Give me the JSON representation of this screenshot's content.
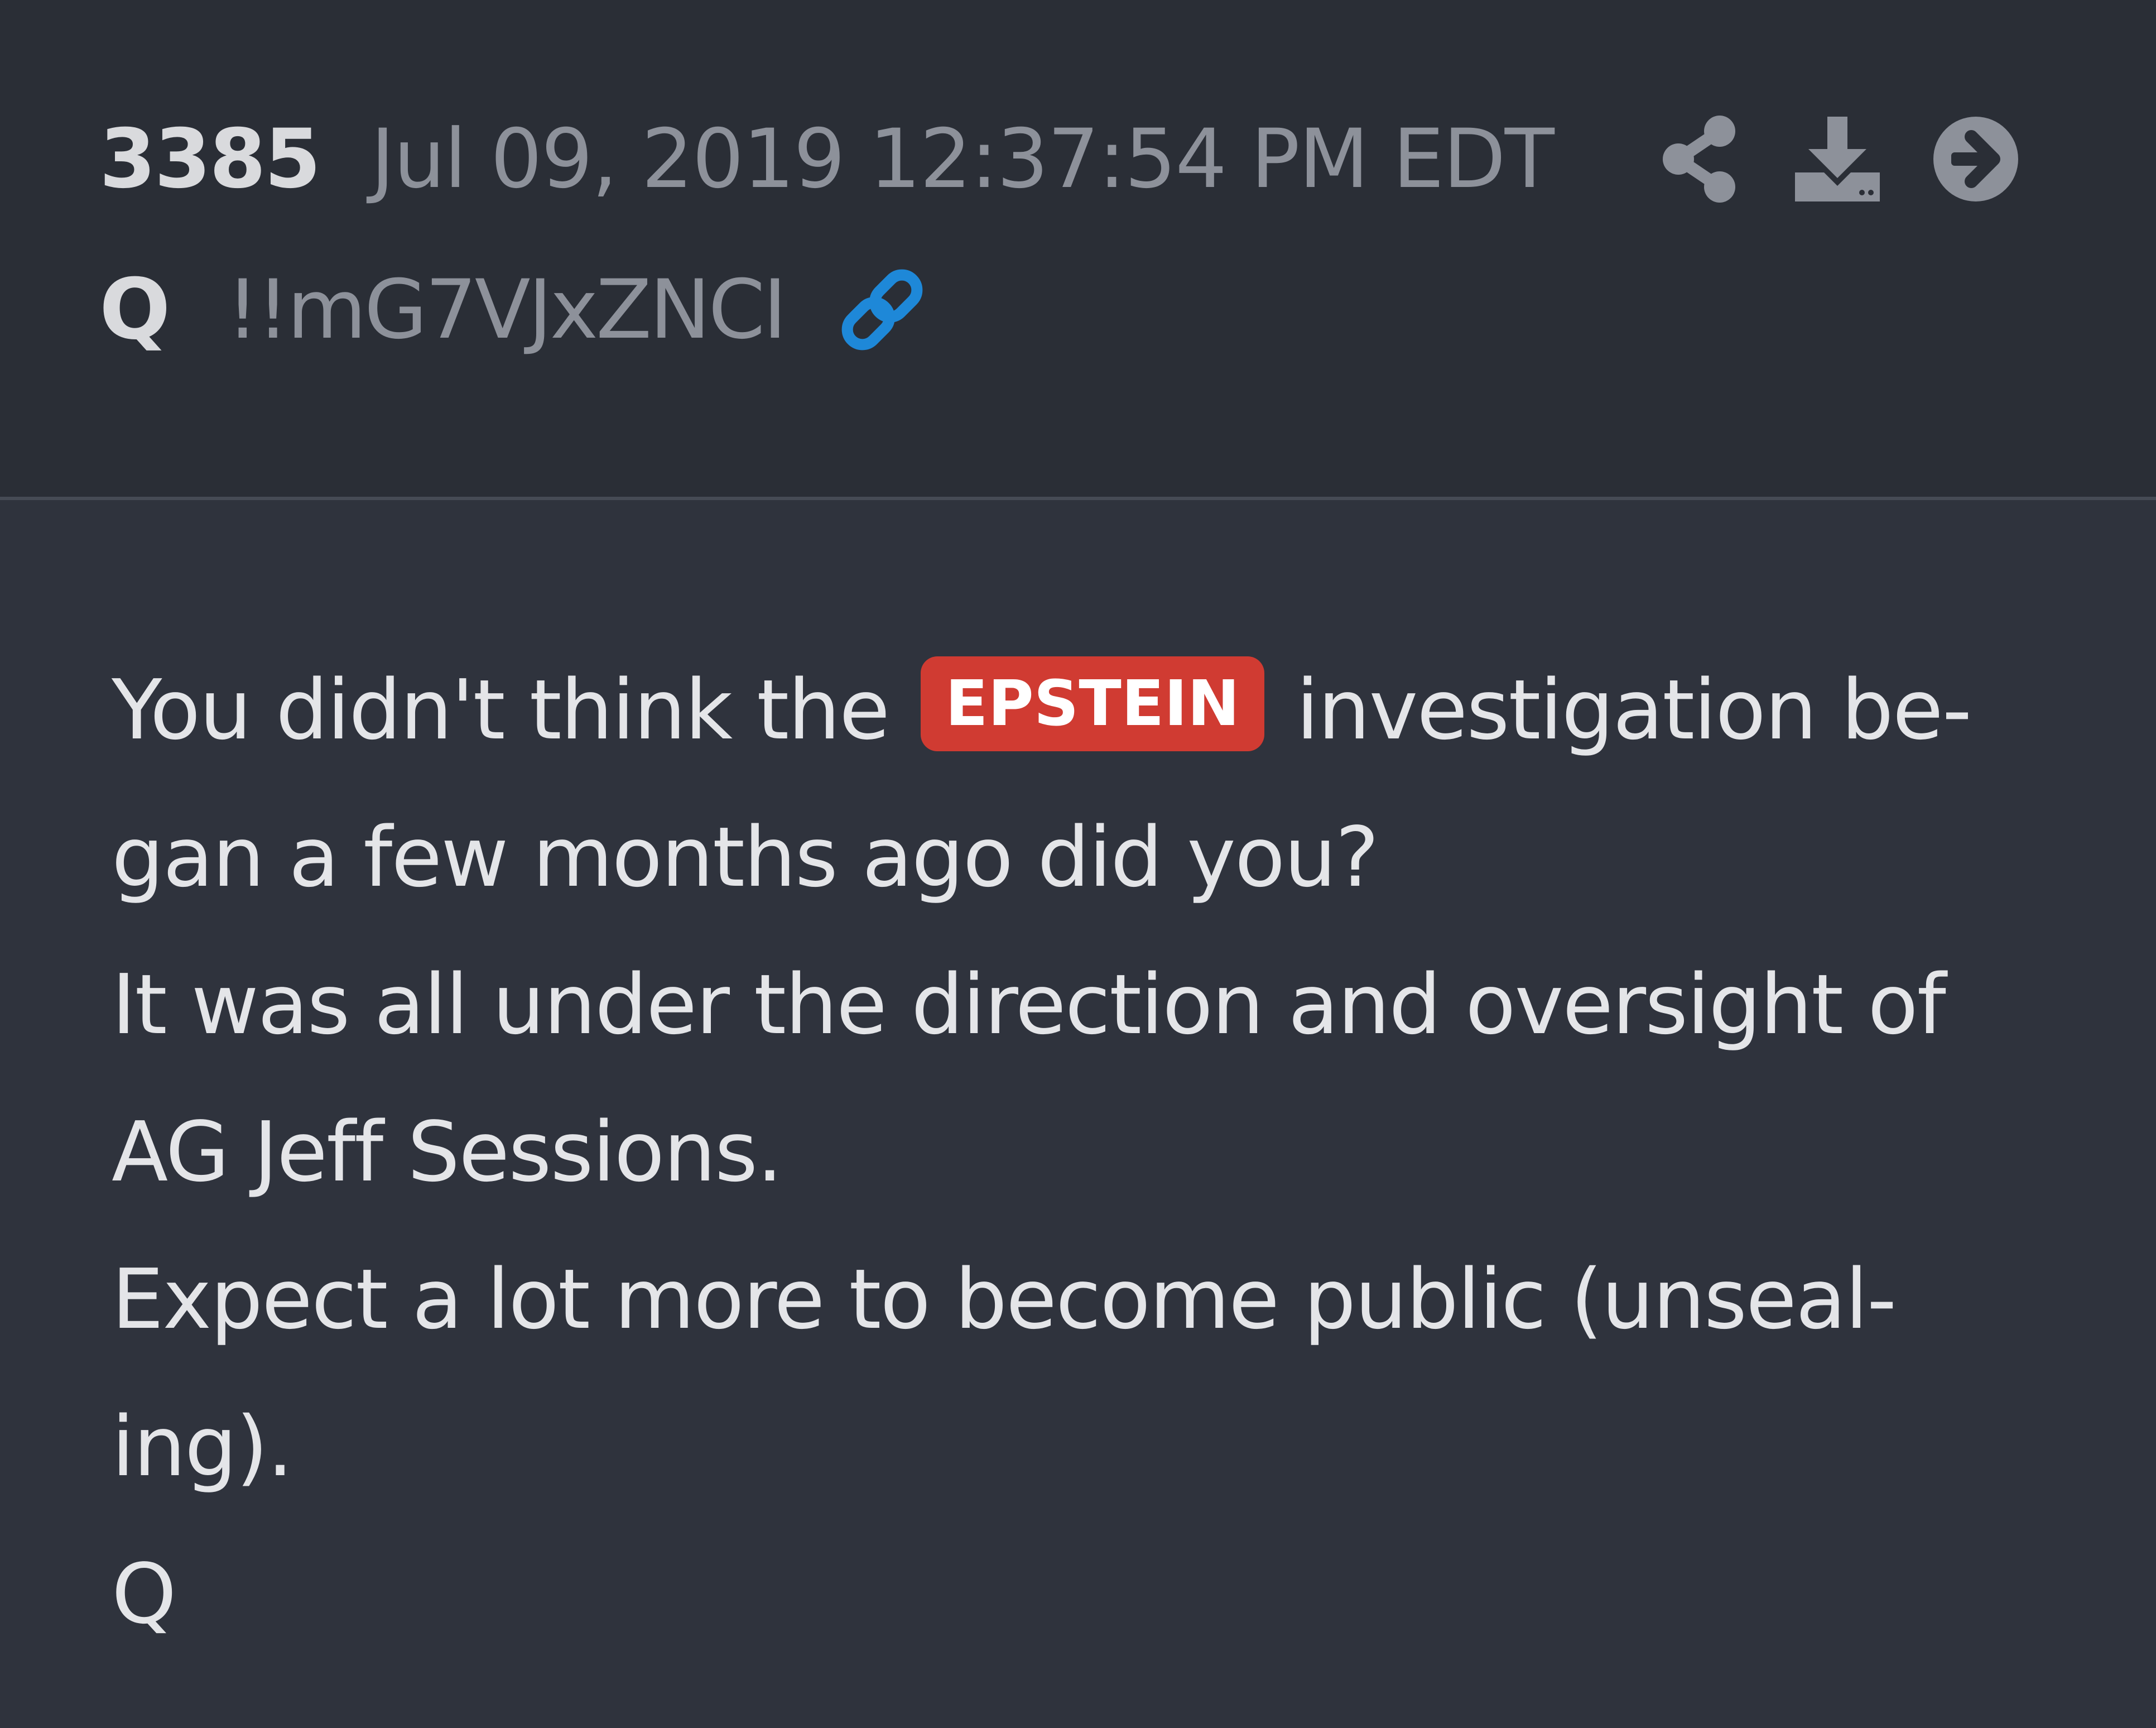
{
  "post": {
    "number": "3385",
    "date": "Jul 09, 2019 12:37:54 PM EDT",
    "author": "Q",
    "tripcode": "!!mG7VJxZNCI"
  },
  "icons": {
    "share": "share-icon",
    "download": "download-icon",
    "goto": "arrow-right-circle-icon",
    "link": "link-icon"
  },
  "colors": {
    "background": "#2f333d",
    "header_background": "#2a2e36",
    "tag": "#d03b32",
    "link": "#1e88d8",
    "muted": "#8d919a",
    "text": "#e4e5e8"
  },
  "body": {
    "line1_before": "You didn't think the",
    "tag": "EPSTEIN",
    "line1_after": "investigation be-",
    "line2": "gan a few months ago did you?",
    "line3": "It was all under the direction and oversight of",
    "line4": "AG Jeff Sessions.",
    "line5": "Expect a lot more to become public (unseal-",
    "line6": "ing).",
    "line7": "Q"
  }
}
